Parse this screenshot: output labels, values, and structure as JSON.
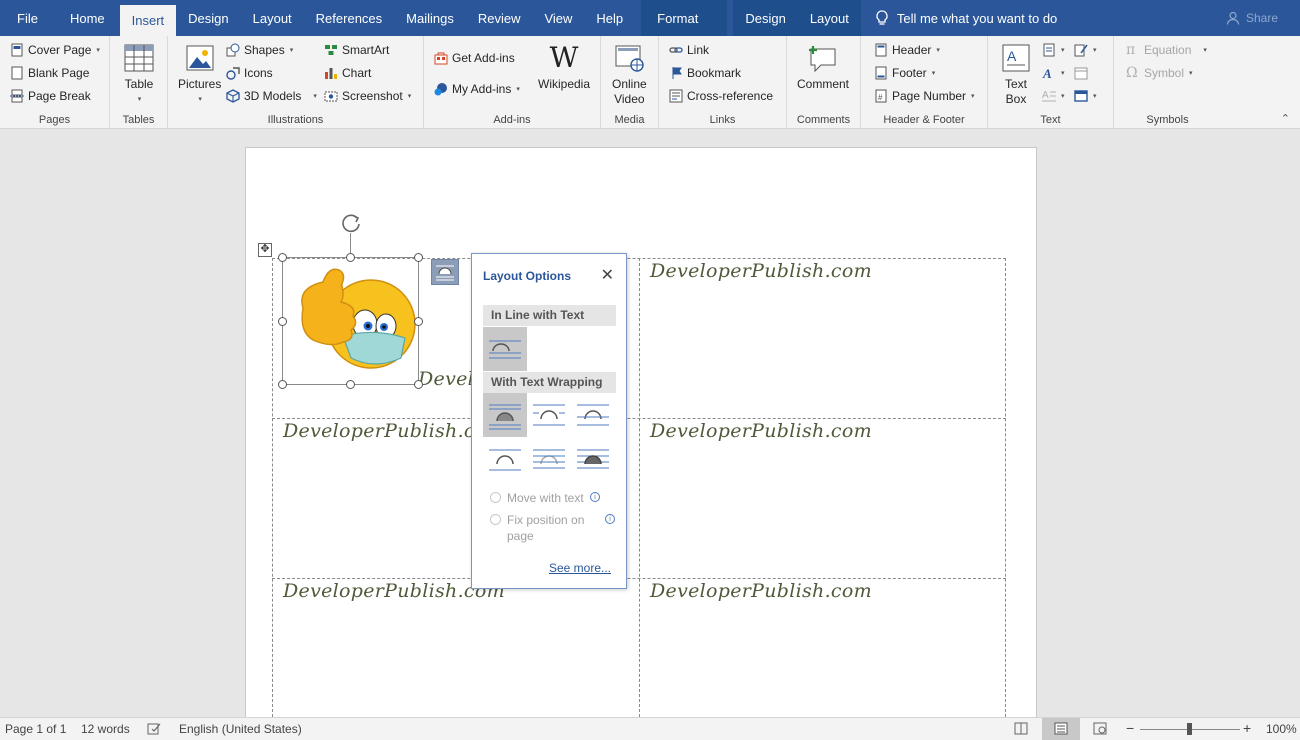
{
  "tabs": {
    "file": "File",
    "home": "Home",
    "insert": "Insert",
    "design": "Design",
    "layout": "Layout",
    "references": "References",
    "mailings": "Mailings",
    "review": "Review",
    "view": "View",
    "help": "Help",
    "format": "Format",
    "design2": "Design",
    "layout2": "Layout"
  },
  "tellme": "Tell me what you want to do",
  "share": "Share",
  "ribbon": {
    "pages": {
      "label": "Pages",
      "cover": "Cover Page",
      "blank": "Blank Page",
      "break": "Page Break"
    },
    "tables": {
      "label": "Tables",
      "table": "Table"
    },
    "illustrations": {
      "label": "Illustrations",
      "pictures": "Pictures",
      "shapes": "Shapes",
      "icons": "Icons",
      "models": "3D Models",
      "smartart": "SmartArt",
      "chart": "Chart",
      "screenshot": "Screenshot"
    },
    "addins": {
      "label": "Add-ins",
      "get": "Get Add-ins",
      "my": "My Add-ins",
      "wikipedia": "Wikipedia"
    },
    "media": {
      "label": "Media",
      "video1": "Online",
      "video2": "Video"
    },
    "links": {
      "label": "Links",
      "link": "Link",
      "bookmark": "Bookmark",
      "xref": "Cross-reference"
    },
    "comments": {
      "label": "Comments",
      "comment": "Comment"
    },
    "hf": {
      "label": "Header & Footer",
      "header": "Header",
      "footer": "Footer",
      "pagenum": "Page Number"
    },
    "text": {
      "label": "Text",
      "textbox1": "Text",
      "textbox2": "Box"
    },
    "symbols": {
      "label": "Symbols",
      "equation": "Equation",
      "symbol": "Symbol"
    }
  },
  "document": {
    "cells": [
      "DeveloperPublish.com",
      "Develo",
      "DeveloperPublish.com",
      "DeveloperPublish.com",
      "DeveloperPublish.com",
      "DeveloperPublish.com"
    ]
  },
  "popup": {
    "title": "Layout Options",
    "inline": "In Line with Text",
    "wrapping": "With Text Wrapping",
    "move": "Move with text",
    "fix1": "Fix position on",
    "fix2": "page",
    "seemore": "See more..."
  },
  "status": {
    "page": "Page 1 of 1",
    "words": "12 words",
    "language": "English (United States)",
    "zoom": "100%"
  },
  "colors": {
    "accent": "#2b579a",
    "text_sample": "#4e5a3a"
  }
}
